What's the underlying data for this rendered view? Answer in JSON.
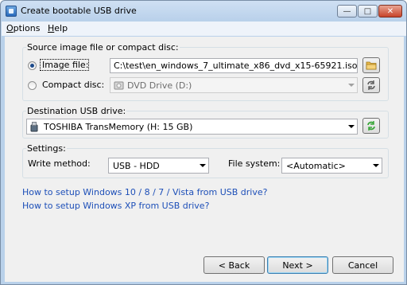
{
  "window": {
    "title": "Create bootable USB drive"
  },
  "menu": [
    {
      "label": "Options",
      "underline": "O",
      "rest": "ptions"
    },
    {
      "label": "Help",
      "underline": "H",
      "rest": "elp"
    }
  ],
  "source": {
    "group_label": "Source image file or compact disc:",
    "image_file": {
      "label": "Image file:",
      "selected": true,
      "value": "C:\\test\\en_windows_7_ultimate_x86_dvd_x15-65921.iso"
    },
    "compact_disc": {
      "label": "Compact disc:",
      "selected": false,
      "value": "DVD Drive (D:)"
    },
    "browse_icon": "folder-icon",
    "refresh_icon": "refresh-icon"
  },
  "destination": {
    "group_label": "Destination USB drive:",
    "value": "TOSHIBA TransMemory (H: 15 GB)",
    "drive_icon": "usb-drive-icon",
    "refresh_icon": "refresh-icon"
  },
  "settings": {
    "group_label": "Settings:",
    "write_method_label": "Write method:",
    "write_method_value": "USB - HDD",
    "file_system_label": "File system:",
    "file_system_value": "<Automatic>"
  },
  "links": [
    "How to setup Windows 10 / 8 / 7 / Vista from USB drive?",
    "How to setup Windows XP from USB drive?"
  ],
  "buttons": {
    "back": "< Back",
    "next": "Next >",
    "cancel": "Cancel"
  },
  "colors": {
    "link": "#1d4fb8",
    "accent_green": "#3aa63a",
    "folder": "#e8b94a"
  }
}
